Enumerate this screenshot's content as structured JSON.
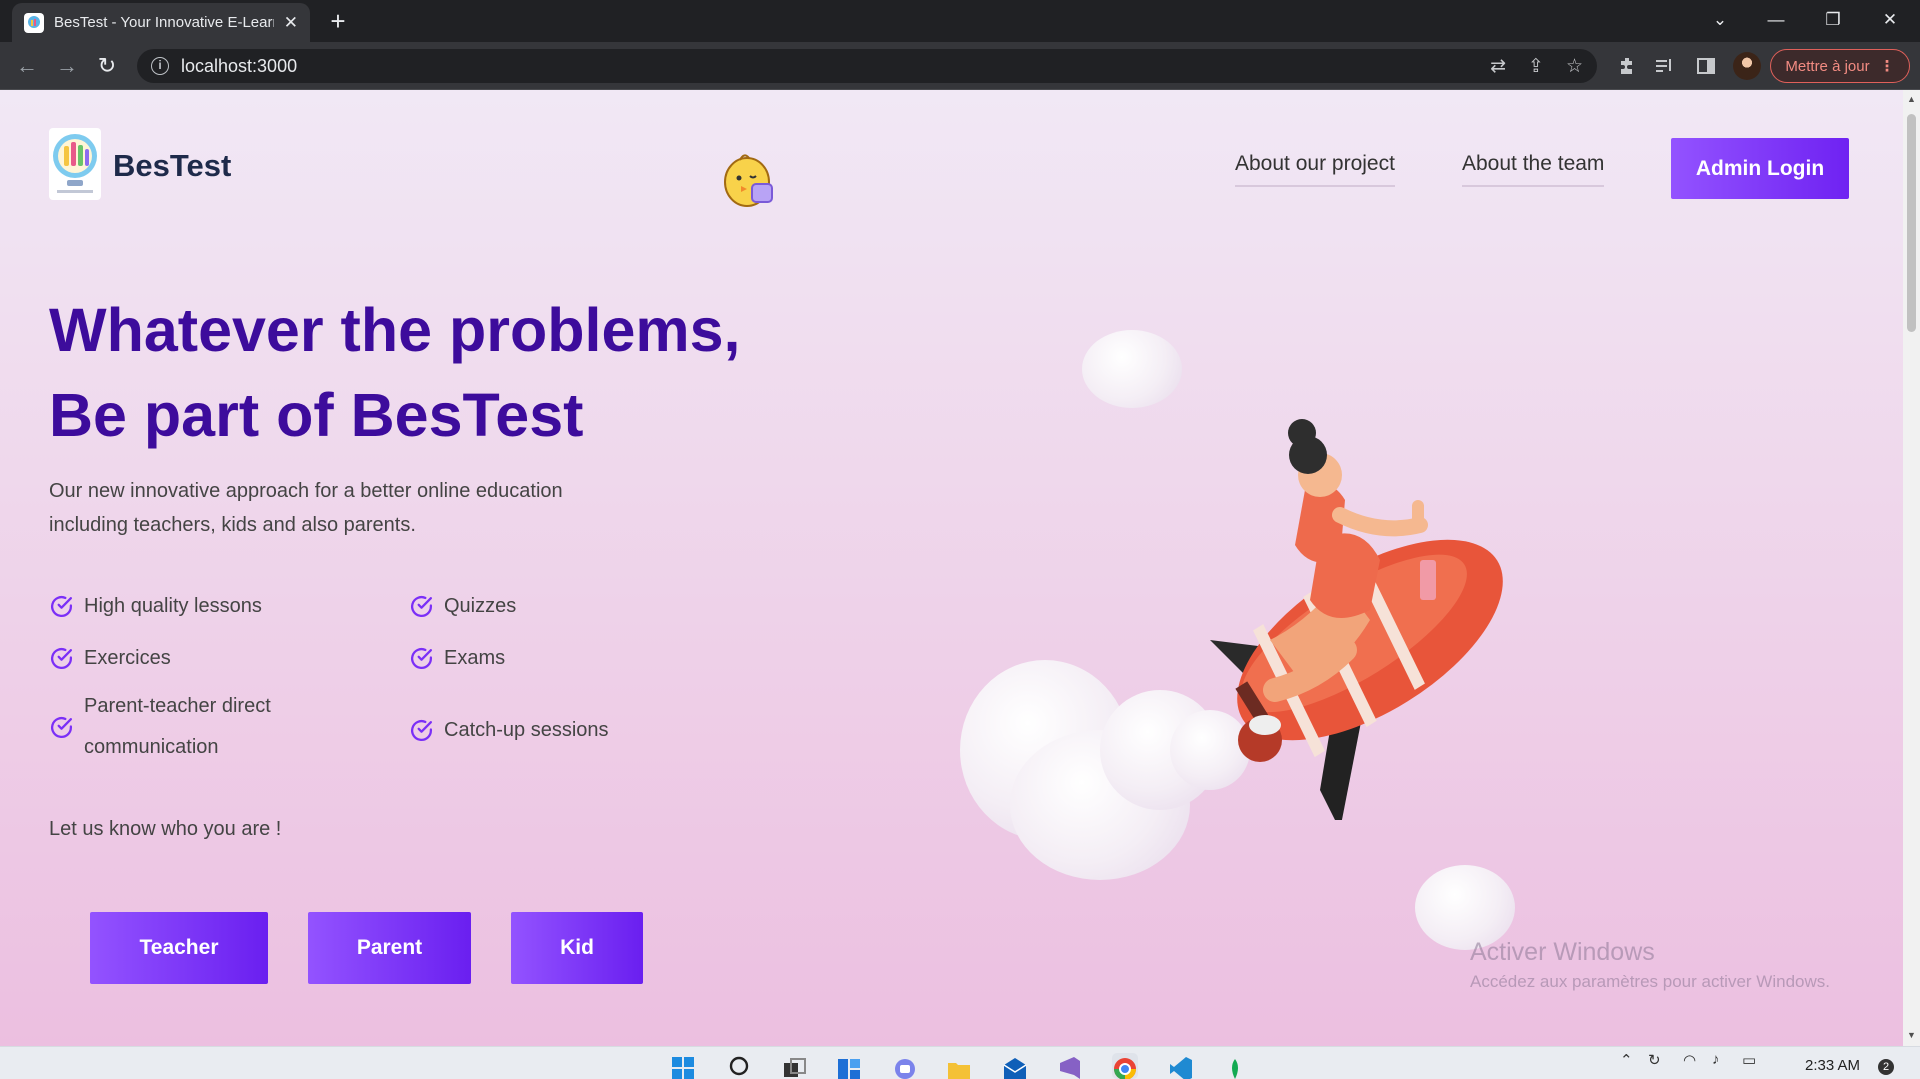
{
  "browser": {
    "tab_title": "BesTest - Your Innovative E-Learn",
    "tab_close": "✕",
    "new_tab": "+",
    "url": "localhost:3000",
    "update_label": "Mettre à jour",
    "update_dots": "⋮"
  },
  "site": {
    "brand": "BesTest",
    "nav": {
      "about_project": "About our project",
      "about_team": "About the team",
      "admin_login": "Admin Login"
    },
    "hero": {
      "title_line1": "Whatever the problems,",
      "title_line2": "Be part of BesTest",
      "subtitle": "Our new innovative approach for a better online education including teachers, kids and also parents."
    },
    "features": {
      "left": [
        "High quality lessons",
        "Exercices",
        "Parent-teacher direct communication"
      ],
      "right": [
        "Quizzes",
        "Exams",
        "Catch-up sessions"
      ]
    },
    "prompt": "Let us know who you are !",
    "roles": [
      "Teacher",
      "Parent",
      "Kid"
    ]
  },
  "watermark": {
    "title": "Activer Windows",
    "subtitle": "Accédez aux paramètres pour activer Windows."
  },
  "taskbar": {
    "time": "2:33 AM"
  },
  "colors": {
    "accent_purple": "#7b2ff7",
    "headline": "#3d0c9c",
    "chrome_dark": "#202124"
  }
}
